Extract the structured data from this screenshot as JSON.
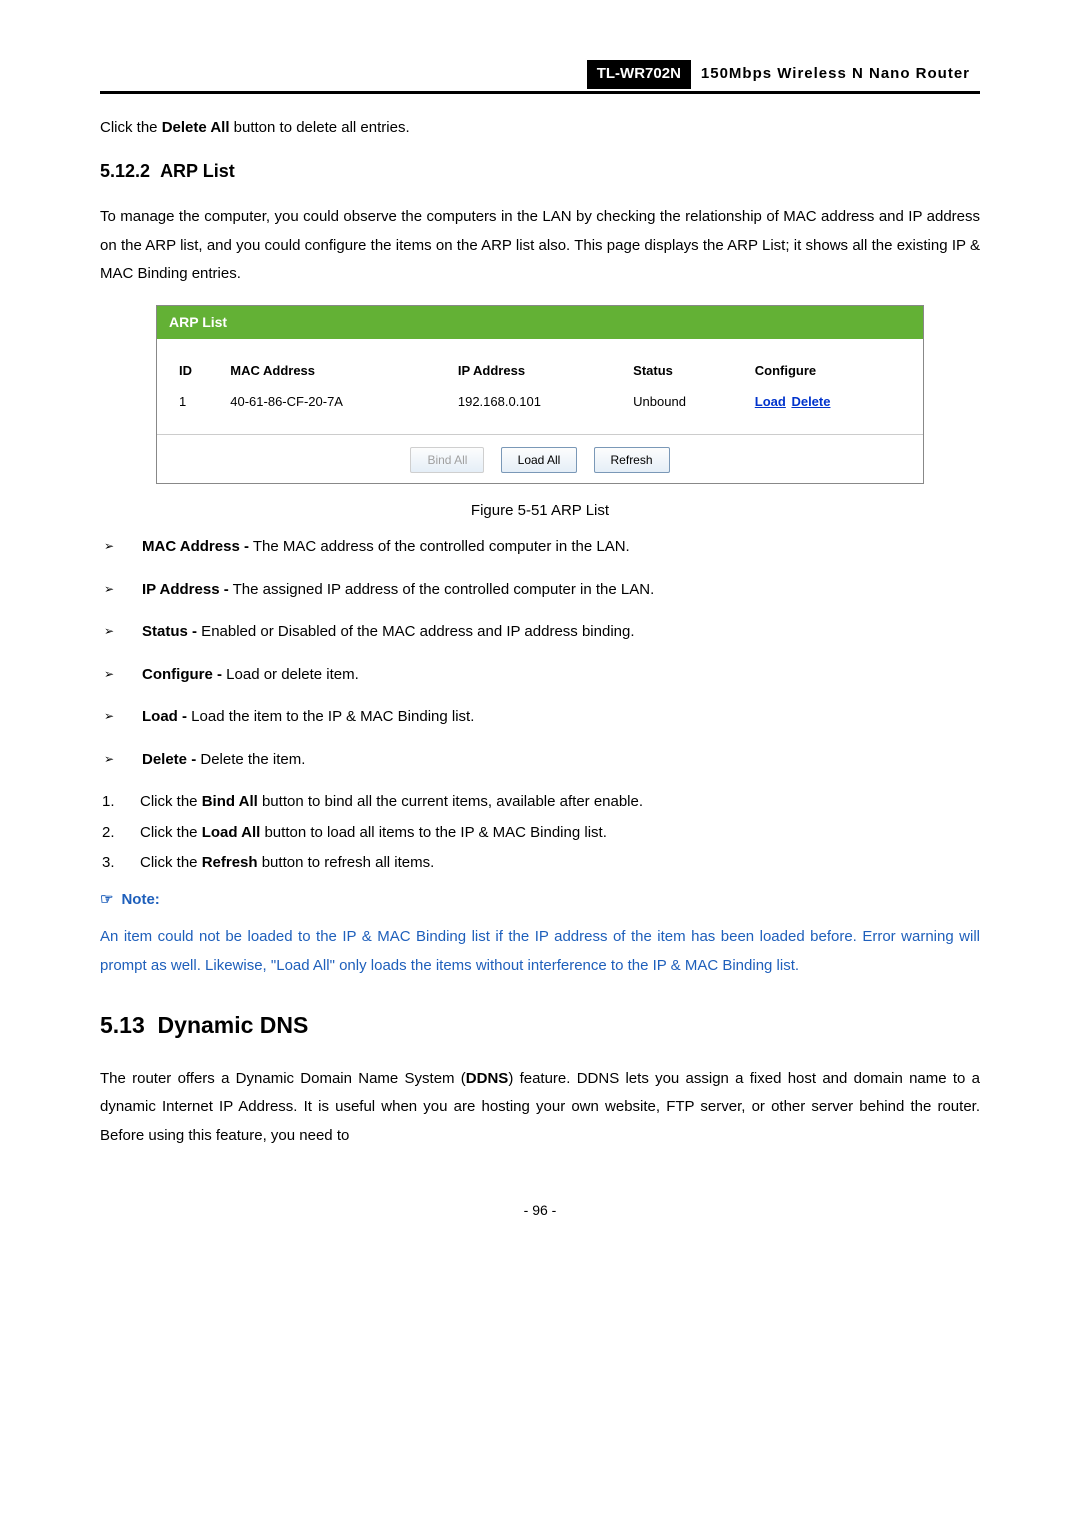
{
  "header": {
    "model": "TL-WR702N",
    "title": "150Mbps  Wireless  N  Nano  Router"
  },
  "intro_sentence_prefix": "Click the ",
  "intro_sentence_bold": "Delete All",
  "intro_sentence_suffix": " button to delete all entries.",
  "section_5_12_2_num": "5.12.2",
  "section_5_12_2_title": "ARP List",
  "paragraph_arp": "To manage the computer, you could observe the computers in the LAN by checking the relationship of MAC address and IP address on the ARP list, and you could configure the items on the ARP list also. This page displays the ARP List; it shows all the existing IP & MAC Binding entries.",
  "screenshot": {
    "title": "ARP List",
    "headers": {
      "id": "ID",
      "mac": "MAC Address",
      "ip": "IP Address",
      "status": "Status",
      "configure": "Configure"
    },
    "row": {
      "id": "1",
      "mac": "40-61-86-CF-20-7A",
      "ip": "192.168.0.101",
      "status": "Unbound",
      "load": "Load",
      "delete": "Delete"
    },
    "buttons": {
      "bind_all": "Bind All",
      "load_all": "Load All",
      "refresh": "Refresh"
    }
  },
  "figure_caption": "Figure 5-51 ARP List",
  "bullets": {
    "mac_bold": "MAC Address -",
    "mac_text": " The MAC address of the controlled computer in the LAN.",
    "ip_bold": "IP Address -",
    "ip_text": " The assigned IP address of the controlled computer in the LAN.",
    "status_bold": "Status -",
    "status_text": " Enabled or Disabled of the MAC address and IP address binding.",
    "configure_bold": "Configure -",
    "configure_text": " Load or delete item.",
    "load_bold": "Load -",
    "load_text": " Load the item to the IP & MAC Binding list.",
    "delete_bold": "Delete -",
    "delete_text": " Delete the item."
  },
  "numbered": {
    "n1_num": "1.",
    "n1_pre": "Click the ",
    "n1_bold": "Bind All",
    "n1_post": " button to bind all the current items, available after enable.",
    "n2_num": "2.",
    "n2_pre": "Click the ",
    "n2_bold": "Load All",
    "n2_post": " button to load all items to the IP & MAC Binding list.",
    "n3_num": "3.",
    "n3_pre": "Click the ",
    "n3_bold": "Refresh",
    "n3_post": " button to refresh all items."
  },
  "note_label": "Note:",
  "note_text": "An item could not be loaded to the IP & MAC Binding list if the IP address of the item has been loaded before. Error warning will prompt as well. Likewise, \"Load All\" only loads the items without interference to the IP & MAC Binding list.",
  "section_5_13_num": "5.13",
  "section_5_13_title": "Dynamic DNS",
  "paragraph_ddns_pre": "The router offers a Dynamic Domain Name System (",
  "paragraph_ddns_bold": "DDNS",
  "paragraph_ddns_post": ") feature. DDNS lets you assign a fixed host and domain name to a dynamic Internet IP Address. It is useful when you are hosting your own website, FTP server, or other server behind the router. Before using this feature, you need to",
  "page_number": "- 96 -"
}
